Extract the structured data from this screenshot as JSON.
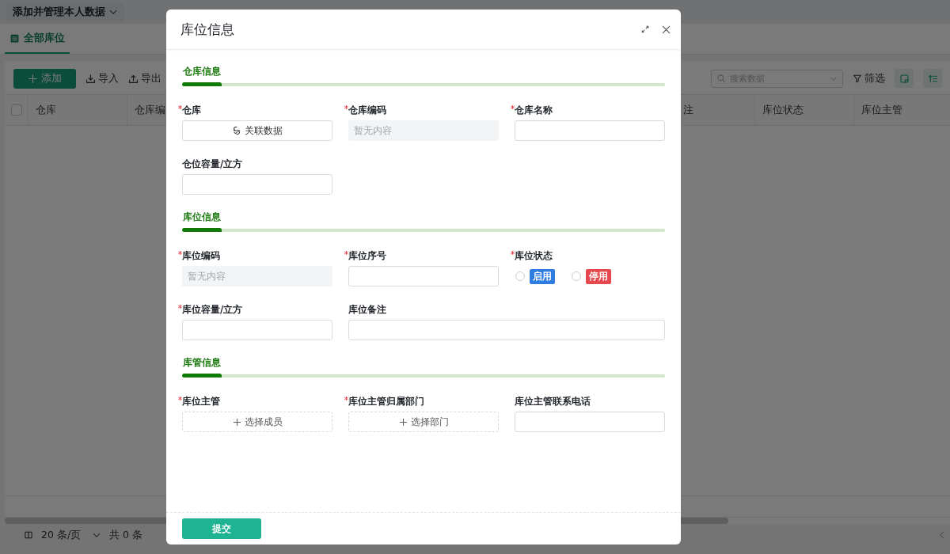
{
  "page": {
    "scope_menu": "添加并管理本人数据",
    "tabs": [
      {
        "label": "全部库位",
        "selected": true
      }
    ],
    "toolbar": {
      "add": "添加",
      "import": "导入",
      "export": "导出",
      "search_placeholder": "搜索数据",
      "filter": "筛选"
    },
    "table": {
      "select_all_checked": false,
      "columns_left": [
        "仓库",
        "仓库编"
      ],
      "columns_right": [
        "注",
        "库位状态",
        "库位主管"
      ]
    },
    "pagination": {
      "page_size": "20 条/页",
      "total": "共 0 条"
    }
  },
  "dialog": {
    "title": "库位信息",
    "sections": [
      {
        "title": "仓库信息",
        "fields": [
          {
            "label": "仓库",
            "required": true,
            "kind": "link",
            "button": "关联数据"
          },
          {
            "label": "仓库编码",
            "required": true,
            "kind": "readonly",
            "placeholder": "暂无内容"
          },
          {
            "label": "仓库名称",
            "required": true,
            "kind": "text"
          },
          {
            "label": "仓位容量/立方",
            "required": false,
            "kind": "text"
          }
        ]
      },
      {
        "title": "库位信息",
        "fields": [
          {
            "label": "库位编码",
            "required": true,
            "kind": "readonly",
            "placeholder": "暂无内容"
          },
          {
            "label": "库位序号",
            "required": true,
            "kind": "text"
          },
          {
            "label": "库位状态",
            "required": true,
            "kind": "radio",
            "options": [
              {
                "label": "启用",
                "color": "#2f7de1",
                "selected": false
              },
              {
                "label": "停用",
                "color": "#e5484d",
                "selected": false
              }
            ]
          },
          {
            "label": "库位容量/立方",
            "required": true,
            "kind": "text"
          },
          {
            "label": "库位备注",
            "required": false,
            "kind": "wide"
          }
        ]
      },
      {
        "title": "库管信息",
        "fields": [
          {
            "label": "库位主管",
            "required": true,
            "kind": "picker",
            "button": "选择成员"
          },
          {
            "label": "库位主管归属部门",
            "required": true,
            "kind": "picker",
            "button": "选择部门"
          },
          {
            "label": "库位主管联系电话",
            "required": false,
            "kind": "text"
          }
        ]
      }
    ],
    "submit": "提交"
  }
}
